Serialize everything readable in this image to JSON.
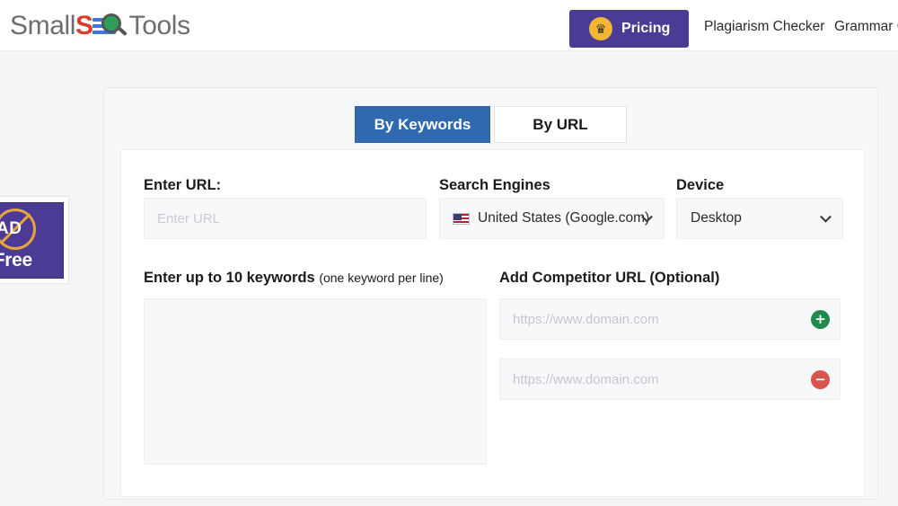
{
  "header": {
    "logo": {
      "part1": "Small",
      "part2": "S",
      "part3": "EO",
      "part4": "Tools",
      "icon": "magnifier-icon"
    },
    "pricing_button": {
      "label": "Pricing",
      "icon": "crown-icon",
      "bg_color": "#4c3b94",
      "badge_color": "#f2b636"
    },
    "nav_links": [
      {
        "label": "Plagiarism Checker"
      },
      {
        "label": "Grammar C"
      }
    ]
  },
  "side_promo": {
    "ad_word": "AD",
    "free_word": "-Free",
    "icon": "no-ads-icon",
    "bg_color": "#4c3b94"
  },
  "tool": {
    "tabs": [
      {
        "label": "By Keywords",
        "active": true
      },
      {
        "label": "By URL",
        "active": false
      }
    ],
    "form": {
      "url_label": "Enter URL:",
      "url_placeholder": "Enter URL",
      "url_value": "",
      "search_engines_label": "Search Engines",
      "search_engine_value": "United States (Google.com)",
      "search_engine_flag": "us-flag-icon",
      "device_label": "Device",
      "device_value": "Desktop",
      "keywords_label": "Enter up to 10 keywords",
      "keywords_label_sub": "(one keyword per line)",
      "keywords_value": "",
      "keywords_placeholder": "",
      "competitor_label": "Add Competitor URL (Optional)",
      "competitors": [
        {
          "placeholder": "https://www.domain.com",
          "value": "",
          "button": "+",
          "button_icon": "add-icon",
          "button_color": "#1f8a4c"
        },
        {
          "placeholder": "https://www.domain.com",
          "value": "",
          "button": "−",
          "button_icon": "remove-icon",
          "button_color": "#d9534f"
        }
      ]
    }
  },
  "colors": {
    "page_bg": "#f4f5f7",
    "tab_active": "#3069b0",
    "panel_bg": "#f7f8fa",
    "card_bg": "#ffffff"
  }
}
